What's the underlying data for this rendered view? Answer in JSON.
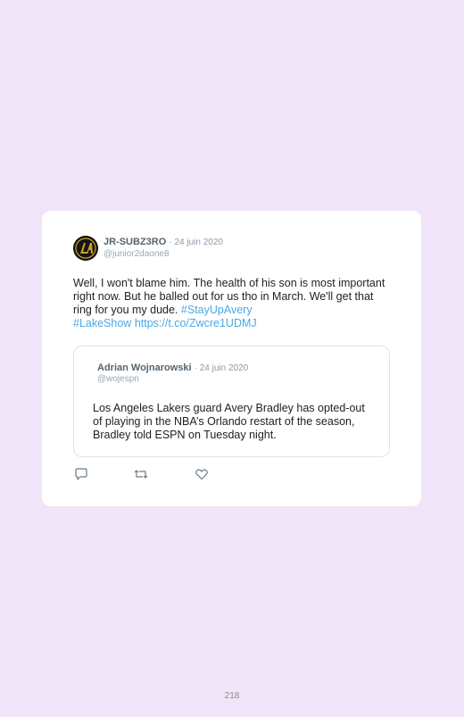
{
  "tweet": {
    "display_name": "JR-SUBZ3RO",
    "date": "· 24 juin 2020",
    "handle": "@junior2daone8",
    "text": "Well, I won't blame him. The health of his son is most important right now. But he balled out for us tho in March. We'll get that ring for you my dude. ",
    "hashtag1": "#StayUpAvery",
    "hashtag2": "#LakeShow",
    "url": "https://t.co/Zwcre1UDMJ"
  },
  "quoted": {
    "display_name": "Adrian Wojnarowski",
    "date": "· 24 juin 2020",
    "handle": "@wojespn",
    "text": "Los Angeles Lakers guard Avery Bradley has opted-out of playing in the NBA’s Orlando restart of the season, Bradley told ESPN on Tuesday night."
  },
  "actions": {
    "reply_icon": "reply-icon",
    "retweet_icon": "retweet-icon",
    "like_icon": "heart-icon"
  },
  "page": {
    "number": "218"
  },
  "colors": {
    "background": "#f0e4f8",
    "link": "#4aa9e8",
    "avatar_gold": "#c9a227"
  }
}
